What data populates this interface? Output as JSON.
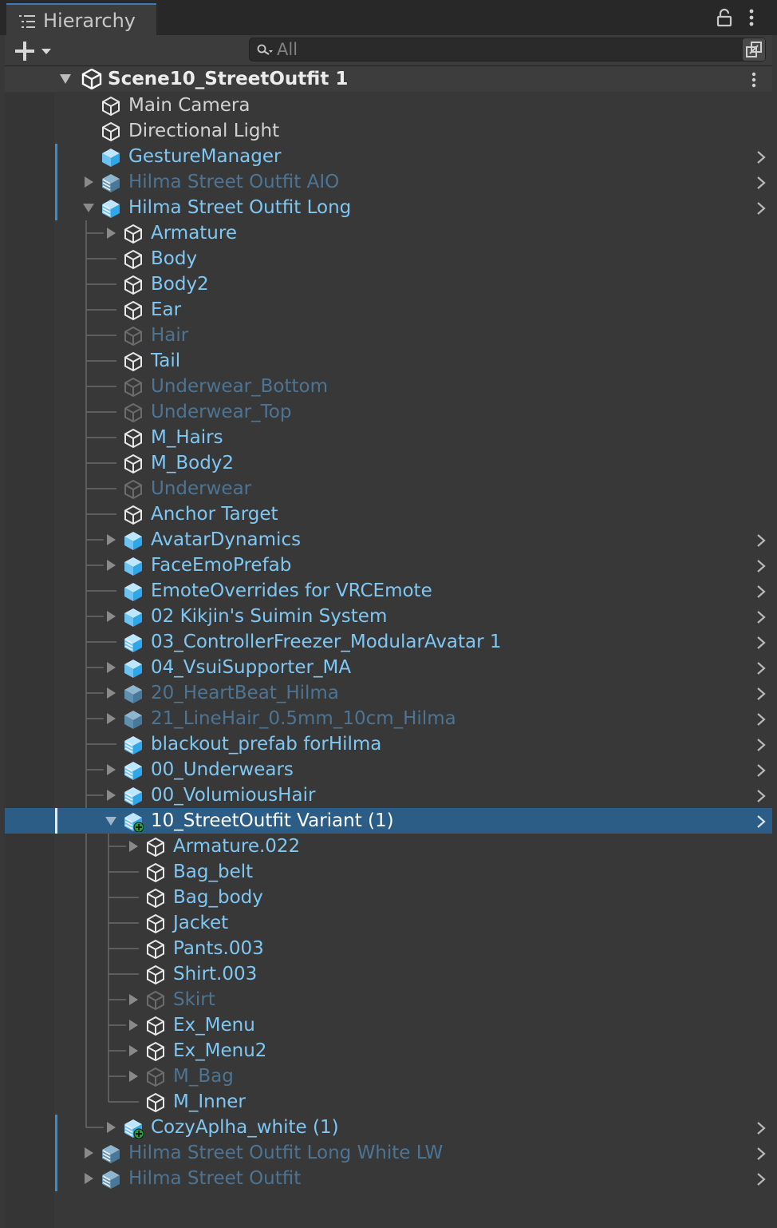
{
  "window": {
    "tab_title": "Hierarchy",
    "icons": {
      "tab": "hierarchy-list-icon",
      "lock": "lock-icon",
      "menu": "more-vertical-icon"
    }
  },
  "toolbar": {
    "add_icon": "plus-dropdown-icon",
    "search": {
      "placeholder": "All",
      "value": "",
      "icon": "search-icon"
    },
    "picker_icon": "scene-picker-icon"
  },
  "colors": {
    "panel_bg": "#383838",
    "selected_row": "#2c5d87",
    "prefab_text": "#7ec8f5",
    "inactive_prefab_text": "#4c7495",
    "normal_text": "#d2d2d2",
    "inactive_text": "#767676"
  },
  "scene": {
    "name": "Scene10_StreetOutfit 1",
    "icon": "unity-scene-icon"
  },
  "items": [
    {
      "label": "Main Camera",
      "depth": 0,
      "arrow": "none",
      "icon": "gameobject-icon",
      "style": "normal"
    },
    {
      "label": "Directional Light",
      "depth": 0,
      "arrow": "none",
      "icon": "gameobject-icon",
      "style": "normal"
    },
    {
      "label": "GestureManager",
      "depth": 0,
      "arrow": "none",
      "icon": "prefab-icon",
      "style": "prefab",
      "chevron": true,
      "mark": true
    },
    {
      "label": "Hilma Street Outfit AIO",
      "depth": 0,
      "arrow": "collapsed",
      "icon": "prefab-model-icon",
      "style": "prefab-inactive",
      "chevron": true,
      "mark": true
    },
    {
      "label": "Hilma Street Outfit Long",
      "depth": 0,
      "arrow": "expanded",
      "icon": "prefab-model-icon",
      "style": "prefab",
      "chevron": true,
      "mark": true
    },
    {
      "label": "Armature",
      "depth": 1,
      "arrow": "collapsed",
      "icon": "gameobject-icon",
      "style": "prefab"
    },
    {
      "label": "Body",
      "depth": 1,
      "arrow": "none",
      "icon": "gameobject-icon",
      "style": "prefab"
    },
    {
      "label": "Body2",
      "depth": 1,
      "arrow": "none",
      "icon": "gameobject-icon",
      "style": "prefab"
    },
    {
      "label": "Ear",
      "depth": 1,
      "arrow": "none",
      "icon": "gameobject-icon",
      "style": "prefab"
    },
    {
      "label": "Hair",
      "depth": 1,
      "arrow": "none",
      "icon": "gameobject-icon",
      "style": "prefab-inactive"
    },
    {
      "label": "Tail",
      "depth": 1,
      "arrow": "none",
      "icon": "gameobject-icon",
      "style": "prefab"
    },
    {
      "label": "Underwear_Bottom",
      "depth": 1,
      "arrow": "none",
      "icon": "gameobject-icon",
      "style": "prefab-inactive"
    },
    {
      "label": "Underwear_Top",
      "depth": 1,
      "arrow": "none",
      "icon": "gameobject-icon",
      "style": "prefab-inactive"
    },
    {
      "label": "M_Hairs",
      "depth": 1,
      "arrow": "none",
      "icon": "gameobject-icon",
      "style": "prefab"
    },
    {
      "label": "M_Body2",
      "depth": 1,
      "arrow": "none",
      "icon": "gameobject-icon",
      "style": "prefab"
    },
    {
      "label": "Underwear",
      "depth": 1,
      "arrow": "none",
      "icon": "gameobject-icon",
      "style": "prefab-inactive"
    },
    {
      "label": "Anchor Target",
      "depth": 1,
      "arrow": "none",
      "icon": "gameobject-icon",
      "style": "prefab"
    },
    {
      "label": "AvatarDynamics",
      "depth": 1,
      "arrow": "collapsed",
      "icon": "prefab-icon",
      "style": "prefab",
      "chevron": true
    },
    {
      "label": "FaceEmoPrefab",
      "depth": 1,
      "arrow": "collapsed",
      "icon": "prefab-icon",
      "style": "prefab",
      "chevron": true
    },
    {
      "label": "EmoteOverrides for VRCEmote",
      "depth": 1,
      "arrow": "none",
      "icon": "prefab-icon",
      "style": "prefab",
      "chevron": true
    },
    {
      "label": "02 Kikjin's Suimin System",
      "depth": 1,
      "arrow": "collapsed",
      "icon": "prefab-icon",
      "style": "prefab",
      "chevron": true
    },
    {
      "label": "03_ControllerFreezer_ModularAvatar 1",
      "depth": 1,
      "arrow": "none",
      "icon": "prefab-model-icon",
      "style": "prefab",
      "chevron": true
    },
    {
      "label": "04_VsuiSupporter_MA",
      "depth": 1,
      "arrow": "collapsed",
      "icon": "prefab-icon",
      "style": "prefab",
      "chevron": true
    },
    {
      "label": "20_HeartBeat_Hilma",
      "depth": 1,
      "arrow": "collapsed",
      "icon": "prefab-icon",
      "style": "prefab-inactive",
      "chevron": true
    },
    {
      "label": "21_LineHair_0.5mm_10cm_Hilma",
      "depth": 1,
      "arrow": "collapsed",
      "icon": "prefab-icon",
      "style": "prefab-inactive",
      "chevron": true
    },
    {
      "label": "blackout_prefab forHilma",
      "depth": 1,
      "arrow": "none",
      "icon": "prefab-model-icon",
      "style": "prefab",
      "chevron": true
    },
    {
      "label": "00_Underwears",
      "depth": 1,
      "arrow": "collapsed",
      "icon": "prefab-model-icon",
      "style": "prefab",
      "chevron": true
    },
    {
      "label": "00_VolumiousHair",
      "depth": 1,
      "arrow": "collapsed",
      "icon": "prefab-model-icon",
      "style": "prefab",
      "chevron": true
    },
    {
      "label": "10_StreetOutfit Variant (1)",
      "depth": 1,
      "arrow": "expanded",
      "icon": "added-prefab-icon",
      "style": "selected",
      "chevron": true,
      "selected": true,
      "mark": true
    },
    {
      "label": "Armature.022",
      "depth": 2,
      "arrow": "collapsed",
      "icon": "gameobject-icon",
      "style": "prefab"
    },
    {
      "label": "Bag_belt",
      "depth": 2,
      "arrow": "none",
      "icon": "gameobject-icon",
      "style": "prefab"
    },
    {
      "label": "Bag_body",
      "depth": 2,
      "arrow": "none",
      "icon": "gameobject-icon",
      "style": "prefab"
    },
    {
      "label": "Jacket",
      "depth": 2,
      "arrow": "none",
      "icon": "gameobject-icon",
      "style": "prefab"
    },
    {
      "label": "Pants.003",
      "depth": 2,
      "arrow": "none",
      "icon": "gameobject-icon",
      "style": "prefab"
    },
    {
      "label": "Shirt.003",
      "depth": 2,
      "arrow": "none",
      "icon": "gameobject-icon",
      "style": "prefab"
    },
    {
      "label": "Skirt",
      "depth": 2,
      "arrow": "collapsed",
      "icon": "gameobject-icon",
      "style": "prefab-inactive"
    },
    {
      "label": "Ex_Menu",
      "depth": 2,
      "arrow": "collapsed",
      "icon": "gameobject-icon",
      "style": "prefab"
    },
    {
      "label": "Ex_Menu2",
      "depth": 2,
      "arrow": "collapsed",
      "icon": "gameobject-icon",
      "style": "prefab"
    },
    {
      "label": "M_Bag",
      "depth": 2,
      "arrow": "collapsed",
      "icon": "gameobject-icon",
      "style": "prefab-inactive"
    },
    {
      "label": "M_Inner",
      "depth": 2,
      "arrow": "none",
      "icon": "gameobject-icon",
      "style": "prefab"
    },
    {
      "label": "CozyAplha_white (1)",
      "depth": 1,
      "arrow": "collapsed",
      "icon": "added-prefab-icon",
      "style": "prefab",
      "chevron": true,
      "mark": true
    },
    {
      "label": "Hilma Street Outfit Long White LW",
      "depth": 0,
      "arrow": "collapsed",
      "icon": "prefab-model-icon",
      "style": "prefab-inactive",
      "chevron": true,
      "mark": true
    },
    {
      "label": "Hilma Street Outfit",
      "depth": 0,
      "arrow": "collapsed",
      "icon": "prefab-model-icon",
      "style": "prefab-inactive",
      "chevron": true,
      "mark": true
    }
  ]
}
